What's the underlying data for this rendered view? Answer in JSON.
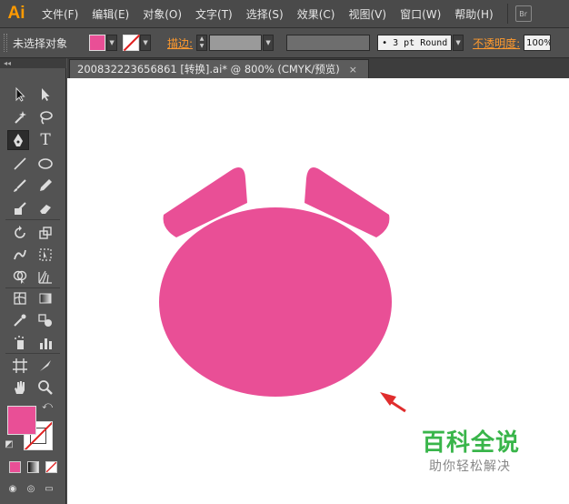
{
  "app": {
    "logo": "Ai"
  },
  "menu": {
    "items": [
      "文件(F)",
      "编辑(E)",
      "对象(O)",
      "文字(T)",
      "选择(S)",
      "效果(C)",
      "视图(V)",
      "窗口(W)",
      "帮助(H)"
    ],
    "bridge_badge": "Br"
  },
  "control_bar": {
    "selection_status": "未选择对象",
    "fill_color": "#e94f96",
    "stroke_label": "描边:",
    "brush_definition": "• 3 pt Round",
    "opacity_label": "不透明度:",
    "opacity_value": "100%"
  },
  "toolbox": {
    "collapse_glyph": "◂◂",
    "fill_color": "#e94f96",
    "stroke_color": "none"
  },
  "document": {
    "tab_title": "200832223656861 [转换].ai* @ 800% (CMYK/预览)",
    "close_glyph": "×",
    "shape_color": "#e94f96",
    "arrow_color": "#e02d2d"
  },
  "watermark": {
    "title": "百科全说",
    "subtitle": "助你轻松解决"
  }
}
